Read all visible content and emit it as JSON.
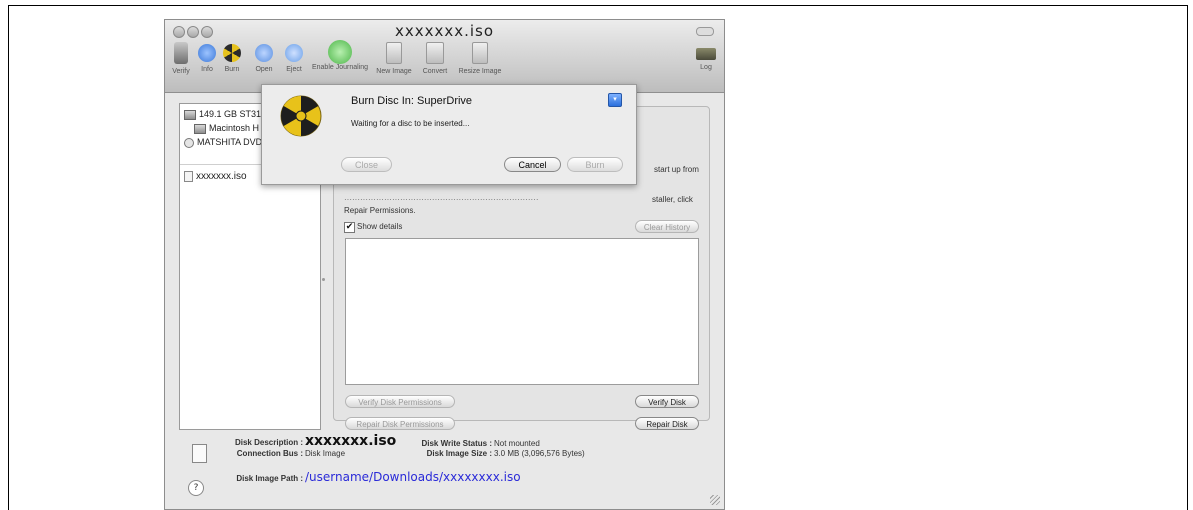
{
  "window": {
    "title": "xxxxxxx.iso"
  },
  "toolbar": {
    "items": [
      {
        "label": "Verify",
        "icon": "microscope-icon",
        "color": "#7a7a7a"
      },
      {
        "label": "Info",
        "icon": "info-icon",
        "color": "#3b78d8"
      },
      {
        "label": "Burn",
        "icon": "burn-icon",
        "color": "#d8b21a"
      },
      {
        "label": "Open",
        "icon": "open-icon",
        "color": "#5a8fe0"
      },
      {
        "label": "Eject",
        "icon": "eject-icon",
        "color": "#6aa0e8"
      },
      {
        "label": "Enable Journaling",
        "icon": "journaling-icon",
        "color": "#4cb548"
      },
      {
        "label": "New Image",
        "icon": "new-image-icon",
        "color": "#bbbbbb"
      },
      {
        "label": "Convert",
        "icon": "convert-icon",
        "color": "#bbbbbb"
      },
      {
        "label": "Resize Image",
        "icon": "resize-image-icon",
        "color": "#bbbbbb"
      }
    ],
    "log_label": "Log"
  },
  "sidebar": {
    "items": [
      {
        "label": "149.1 GB ST316",
        "icon": "hard-drive-icon"
      },
      {
        "label": "Macintosh H",
        "icon": "volume-icon"
      },
      {
        "label": "MATSHITA DVD",
        "icon": "dvd-drive-icon"
      },
      {
        "label": "xxxxxxx.iso",
        "icon": "disk-image-icon"
      }
    ]
  },
  "panel": {
    "start_up_text": "start up from",
    "installer_text": "staller, click",
    "repair_permissions_text": "Repair Permissions.",
    "show_details_label": "Show details",
    "show_details_checked": true,
    "clear_history_label": "Clear History",
    "verify_permissions_label": "Verify Disk Permissions",
    "verify_disk_label": "Verify Disk",
    "repair_permissions_label": "Repair Disk Permissions",
    "repair_disk_label": "Repair Disk"
  },
  "sheet": {
    "title": "Burn Disc In:  SuperDrive",
    "status": "Waiting for a disc to be inserted...",
    "close_label": "Close",
    "cancel_label": "Cancel",
    "burn_label": "Burn"
  },
  "info": {
    "disk_description_label": "Disk Description :",
    "disk_description_value": "xxxxxxx.iso",
    "connection_bus_label": "Connection Bus :",
    "connection_bus_value": "Disk Image",
    "write_status_label": "Disk Write Status :",
    "write_status_value": "Not mounted",
    "image_size_label": "Disk Image Size :",
    "image_size_value": "3.0 MB (3,096,576 Bytes)",
    "image_path_label": "Disk Image Path :",
    "image_path_value": "/username/Downloads/xxxxxxxx.iso",
    "help_symbol": "?"
  }
}
